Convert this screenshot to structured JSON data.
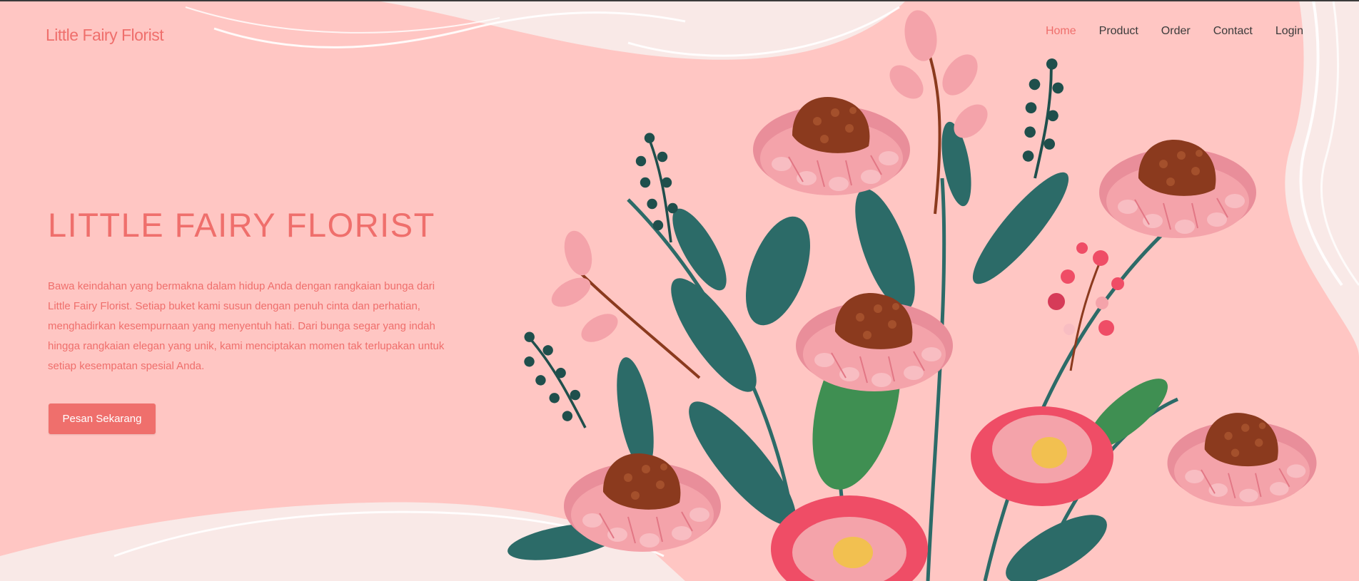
{
  "nav": {
    "brand": "Little Fairy Florist",
    "items": [
      {
        "label": "Home",
        "active": true
      },
      {
        "label": "Product",
        "active": false
      },
      {
        "label": "Order",
        "active": false
      },
      {
        "label": "Contact",
        "active": false
      },
      {
        "label": "Login",
        "active": false
      }
    ]
  },
  "hero": {
    "title": "LITTLE FAIRY FLORIST",
    "description": "Bawa keindahan yang bermakna dalam hidup Anda dengan rangkaian bunga dari Little Fairy Florist. Setiap buket kami susun dengan penuh cinta dan perhatian, menghadirkan kesempurnaan yang menyentuh hati. Dari bunga segar yang indah hingga rangkaian elegan yang unik, kami menciptakan momen tak terlupakan untuk setiap kesempatan spesial Anda.",
    "cta_label": "Pesan Sekarang"
  },
  "colors": {
    "accent": "#ef6f6c",
    "background_pink": "#ffc6c3",
    "background_cream": "#f9e9e7",
    "nav_text": "#3b3b3b",
    "petal_pink": "#f4a3aa",
    "flower_center": "#8b3a1e",
    "leaf_teal": "#2c6b68",
    "bloom_red": "#ef4d66"
  },
  "icons": [
    "flower-bouquet-illustration"
  ]
}
